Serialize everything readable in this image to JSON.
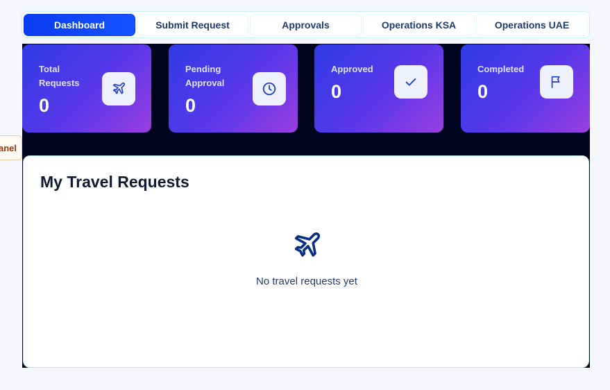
{
  "tabs": [
    {
      "label": "Dashboard",
      "active": true
    },
    {
      "label": "Submit Request",
      "active": false
    },
    {
      "label": "Approvals",
      "active": false
    },
    {
      "label": "Operations KSA",
      "active": false
    },
    {
      "label": "Operations UAE",
      "active": false
    }
  ],
  "stats": [
    {
      "label": "Total Requests",
      "value": "0",
      "icon": "airplane-icon"
    },
    {
      "label": "Pending Approval",
      "value": "0",
      "icon": "clock-icon"
    },
    {
      "label": "Approved",
      "value": "0",
      "icon": "check-icon"
    },
    {
      "label": "Completed",
      "value": "0",
      "icon": "flag-icon"
    }
  ],
  "side_chip": {
    "label": "anel"
  },
  "requests": {
    "title": "My Travel Requests",
    "empty_icon": "airplane-icon",
    "empty_message": "No travel requests yet"
  },
  "colors": {
    "accent": "#0a3df0",
    "card_gradient_start": "#2f3be6",
    "card_gradient_end": "#9a3ee0",
    "dark_background": "#02031f",
    "icon_color": "#1a3fd6"
  }
}
